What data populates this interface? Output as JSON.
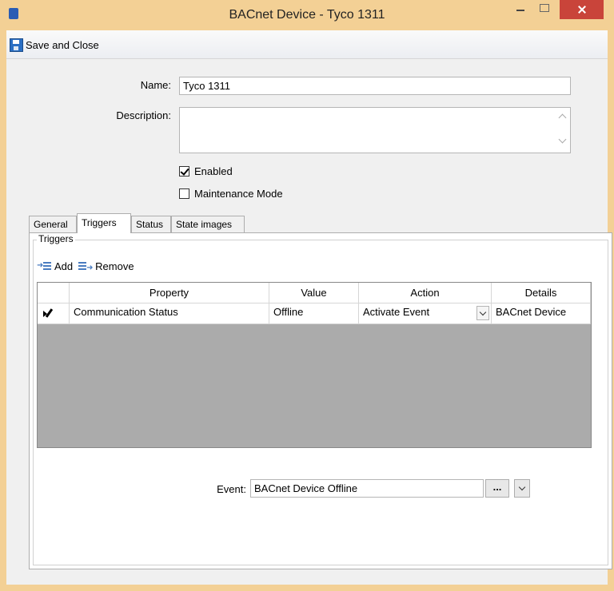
{
  "window": {
    "title": "BACnet Device  -  Tyco 1311"
  },
  "toolbar": {
    "save_close_label": "Save and Close"
  },
  "form": {
    "name_label": "Name:",
    "name_value": "Tyco 1311",
    "description_label": "Description:",
    "description_value": "",
    "enabled_label": "Enabled",
    "enabled_checked": true,
    "maintenance_label": "Maintenance Mode",
    "maintenance_checked": false
  },
  "tabs": [
    {
      "label": "General",
      "active": false
    },
    {
      "label": "Triggers",
      "active": true
    },
    {
      "label": "Status",
      "active": false
    },
    {
      "label": "State images",
      "active": false
    }
  ],
  "triggers": {
    "group_label": "Triggers",
    "add_label": "Add",
    "remove_label": "Remove",
    "columns": [
      "Property",
      "Value",
      "Action",
      "Details"
    ],
    "rows": [
      {
        "property": "Communication Status",
        "value": "Offline",
        "action": "Activate Event",
        "details": "BACnet Device"
      }
    ],
    "event_label": "Event:",
    "event_value": "BACnet Device Offline",
    "event_browse_label": "..."
  },
  "colors": {
    "title_bar": "#f3d095",
    "close_button": "#c9443a"
  }
}
